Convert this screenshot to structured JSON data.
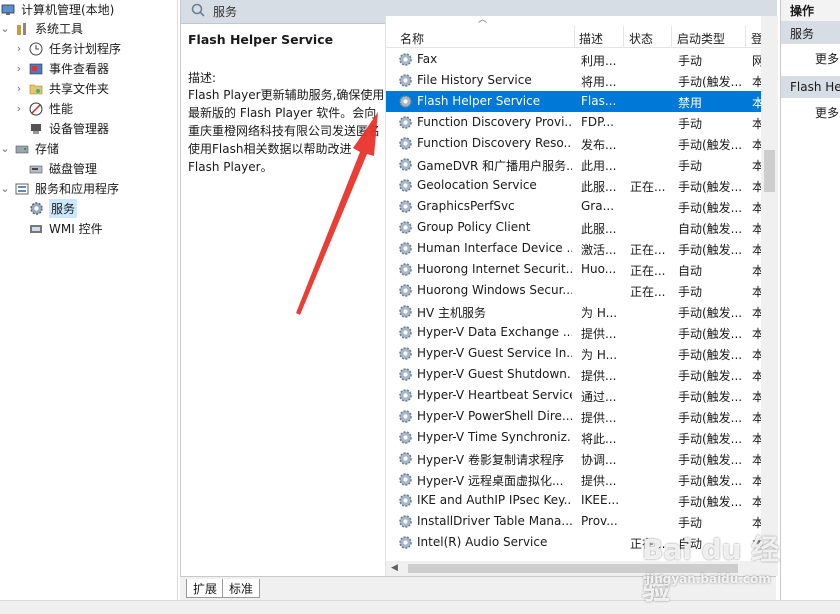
{
  "tree": {
    "items": [
      {
        "label": "计算机管理(本地)",
        "icon": "computer-management-icon"
      },
      {
        "label": "系统工具",
        "icon": "system-tools-icon"
      },
      {
        "label": "任务计划程序",
        "icon": "task-scheduler-icon"
      },
      {
        "label": "事件查看器",
        "icon": "event-viewer-icon"
      },
      {
        "label": "共享文件夹",
        "icon": "shared-folders-icon"
      },
      {
        "label": "性能",
        "icon": "performance-icon"
      },
      {
        "label": "设备管理器",
        "icon": "device-manager-icon"
      },
      {
        "label": "存储",
        "icon": "storage-icon"
      },
      {
        "label": "磁盘管理",
        "icon": "disk-management-icon"
      },
      {
        "label": "服务和应用程序",
        "icon": "services-and-apps-icon"
      },
      {
        "label": "服务",
        "icon": "services-icon"
      },
      {
        "label": "WMI 控件",
        "icon": "wmi-control-icon"
      }
    ]
  },
  "desc_pane": {
    "header": "服务",
    "service_title": "Flash Helper Service",
    "desc_label": "描述:",
    "desc_text": "Flash Player更新辅助服务,确保使用最新版的 Flash Player 软件。会向重庆重橙网络科技有限公司发送匿名使用Flash相关数据以帮助改进 Flash Player。"
  },
  "list": {
    "columns": [
      "名称",
      "描述",
      "状态",
      "启动类型",
      "登"
    ],
    "rows": [
      {
        "name": "Fax",
        "desc": "利用...",
        "status": "",
        "startup": "手动",
        "logon": "网"
      },
      {
        "name": "File History Service",
        "desc": "将用...",
        "status": "",
        "startup": "手动(触发...",
        "logon": "本"
      },
      {
        "name": "Flash Helper Service",
        "desc": "Flas...",
        "status": "",
        "startup": "禁用",
        "logon": "本"
      },
      {
        "name": "Function Discovery Provi...",
        "desc": "FDP...",
        "status": "",
        "startup": "手动",
        "logon": "本"
      },
      {
        "name": "Function Discovery Reso...",
        "desc": "发布...",
        "status": "",
        "startup": "手动(触发...",
        "logon": "本"
      },
      {
        "name": "GameDVR 和广播用户服务...",
        "desc": "此用...",
        "status": "",
        "startup": "手动",
        "logon": "本"
      },
      {
        "name": "Geolocation Service",
        "desc": "此服...",
        "status": "正在...",
        "startup": "手动(触发...",
        "logon": "本"
      },
      {
        "name": "GraphicsPerfSvc",
        "desc": "Gra...",
        "status": "",
        "startup": "手动(触发...",
        "logon": "本"
      },
      {
        "name": "Group Policy Client",
        "desc": "此服...",
        "status": "",
        "startup": "自动(触发...",
        "logon": "本"
      },
      {
        "name": "Human Interface Device ...",
        "desc": "激活...",
        "status": "正在...",
        "startup": "手动(触发...",
        "logon": "本"
      },
      {
        "name": "Huorong Internet Securit...",
        "desc": "Huo...",
        "status": "正在...",
        "startup": "自动",
        "logon": "本"
      },
      {
        "name": "Huorong Windows Secur...",
        "desc": "",
        "status": "正在...",
        "startup": "手动",
        "logon": "本"
      },
      {
        "name": "HV 主机服务",
        "desc": "为 H...",
        "status": "",
        "startup": "手动(触发...",
        "logon": "本"
      },
      {
        "name": "Hyper-V Data Exchange ...",
        "desc": "提供...",
        "status": "",
        "startup": "手动(触发...",
        "logon": "本"
      },
      {
        "name": "Hyper-V Guest Service In...",
        "desc": "为 H...",
        "status": "",
        "startup": "手动(触发...",
        "logon": "本"
      },
      {
        "name": "Hyper-V Guest Shutdown...",
        "desc": "提供...",
        "status": "",
        "startup": "手动(触发...",
        "logon": "本"
      },
      {
        "name": "Hyper-V Heartbeat Service",
        "desc": "通过...",
        "status": "",
        "startup": "手动(触发...",
        "logon": "本"
      },
      {
        "name": "Hyper-V PowerShell Dire...",
        "desc": "提供...",
        "status": "",
        "startup": "手动(触发...",
        "logon": "本"
      },
      {
        "name": "Hyper-V Time Synchroniz...",
        "desc": "将此...",
        "status": "",
        "startup": "手动(触发...",
        "logon": "本"
      },
      {
        "name": "Hyper-V 卷影复制请求程序",
        "desc": "协调...",
        "status": "",
        "startup": "手动(触发...",
        "logon": "本"
      },
      {
        "name": "Hyper-V 远程桌面虚拟化...",
        "desc": "提供...",
        "status": "",
        "startup": "手动(触发...",
        "logon": "本"
      },
      {
        "name": "IKE and AuthIP IPsec Key...",
        "desc": "IKEE...",
        "status": "",
        "startup": "手动(触发...",
        "logon": "本"
      },
      {
        "name": "InstallDriver Table Mana...",
        "desc": "Prov...",
        "status": "",
        "startup": "手动",
        "logon": "本"
      },
      {
        "name": "Intel(R) Audio Service",
        "desc": "",
        "status": "正在...",
        "startup": "自动",
        "logon": "本"
      }
    ]
  },
  "tabs": [
    "扩展",
    "标准"
  ],
  "actions": {
    "title": "操作",
    "group1": "服务",
    "more1": "更多",
    "group2": "Flash He",
    "more2": "更多"
  },
  "watermark": {
    "brand": "Bai du 经验",
    "sub": "jingyan.baidu.com"
  },
  "colors": {
    "selection": "#0078d7",
    "tree_selection": "#cce8ff",
    "annotation_arrow": "#e8332a",
    "header_bg": "#d6dde5"
  }
}
